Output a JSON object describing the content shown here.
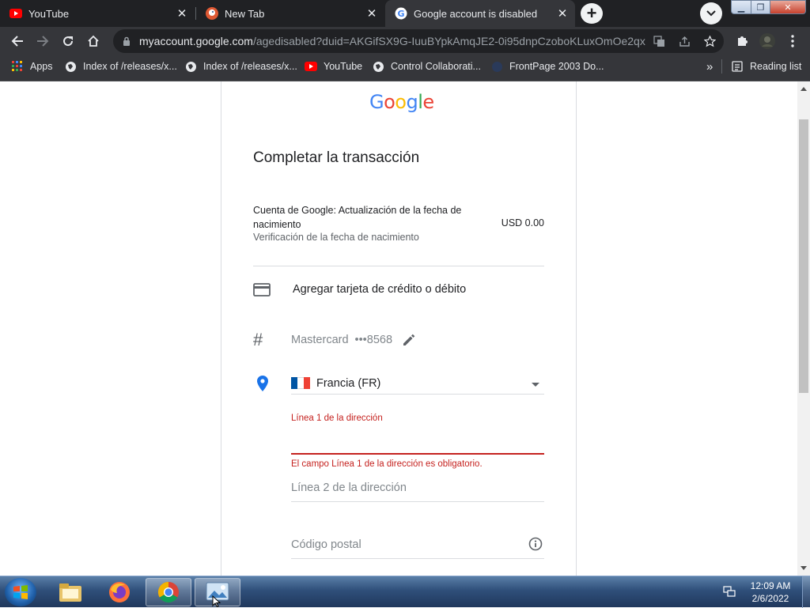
{
  "browser": {
    "tabs": [
      {
        "title": "YouTube",
        "favicon": "youtube-icon"
      },
      {
        "title": "New Tab",
        "favicon": "duckduckgo-icon"
      },
      {
        "title": "Google account is disabled",
        "favicon": "google-icon",
        "active": true
      }
    ],
    "url": {
      "host": "myaccount.google.com",
      "path": "/agedisabled?duid=AKGifSX9G-IuuBYpkAmqJE2-0i95dnpCzoboKLuxOmOe2qx..."
    },
    "bookmarks": [
      {
        "label": "Apps",
        "icon": "apps-grid-icon"
      },
      {
        "label": "Index of /releases/x...",
        "icon": "globe-icon"
      },
      {
        "label": "Index of /releases/x...",
        "icon": "globe-icon"
      },
      {
        "label": "YouTube",
        "icon": "youtube-icon"
      },
      {
        "label": "Control Collaborati...",
        "icon": "globe-icon"
      },
      {
        "label": "FrontPage 2003 Do...",
        "icon": "frontpage-icon"
      }
    ],
    "overflow_label": "»",
    "reading_list": "Reading list"
  },
  "page": {
    "logo": "Google",
    "heading": "Completar la transacción",
    "item": {
      "name": "Cuenta de Google: Actualización de la fecha de nacimiento",
      "subtitle": "Verificación de la fecha de nacimiento",
      "price": "USD 0.00"
    },
    "add_card_label": "Agregar tarjeta de crédito o débito",
    "card": {
      "brand": "Mastercard",
      "masked": "•••8568"
    },
    "country": {
      "value": "Francia (FR)",
      "flag_colors": [
        "#0055a4",
        "#ffffff",
        "#ef4135"
      ]
    },
    "address1": {
      "label": "Línea 1 de la dirección",
      "error": "El campo Línea 1 de la dirección es obligatorio."
    },
    "address2": {
      "placeholder": "Línea 2 de la dirección"
    },
    "postal": {
      "placeholder": "Código postal"
    }
  },
  "taskbar": {
    "apps": [
      "file-explorer-icon",
      "firefox-icon",
      "chrome-icon",
      "image-viewer-icon"
    ],
    "time": "12:09 AM",
    "date": "2/6/2022"
  },
  "colors": {
    "error": "#c5221f",
    "accent_blue": "#4285f4"
  }
}
